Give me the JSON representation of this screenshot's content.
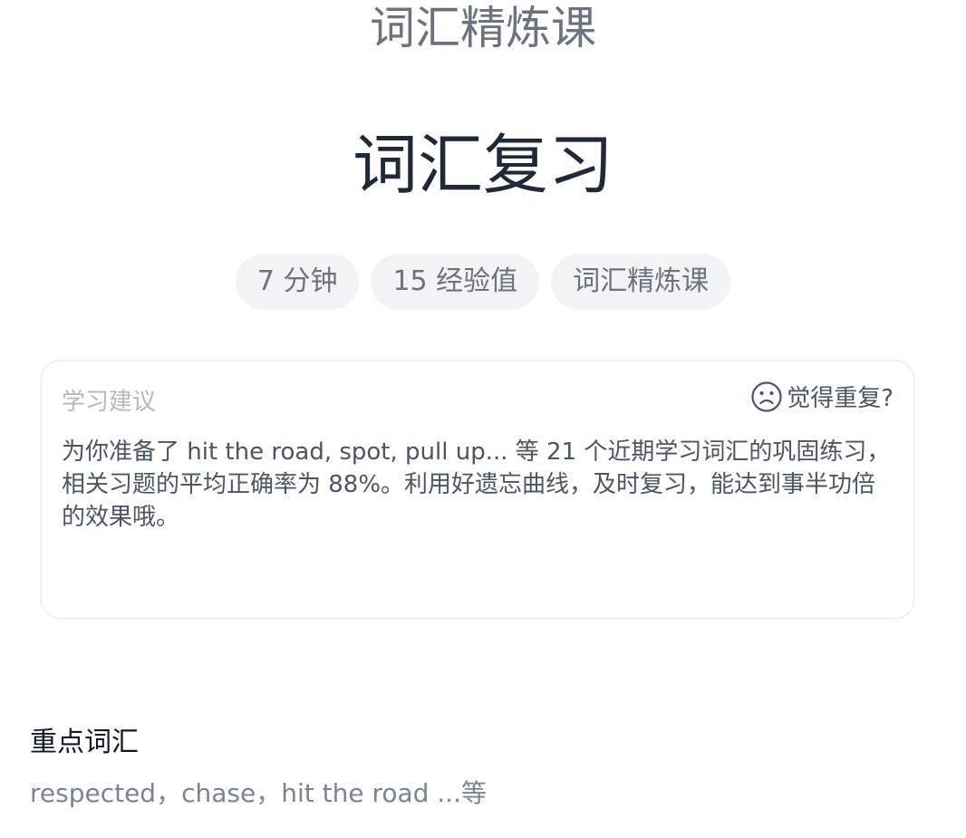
{
  "header": {
    "course_name": "词汇精炼课",
    "title": "词汇复习"
  },
  "tags": [
    {
      "label": "7 分钟"
    },
    {
      "label": "15 经验值"
    },
    {
      "label": "词汇精炼课"
    }
  ],
  "suggestion_card": {
    "label": "学习建议",
    "feedback_label": "觉得重复?",
    "feedback_icon": "sad-face-icon",
    "text": "为你准备了 hit the road, spot, pull up... 等 21 个近期学习词汇的巩固练习，相关习题的平均正确率为 88%。利用好遗忘曲线，及时复习，能达到事半功倍的效果哦。"
  },
  "key_vocabulary": {
    "title": "重点词汇",
    "words": "respected，chase，hit the road ...等"
  }
}
